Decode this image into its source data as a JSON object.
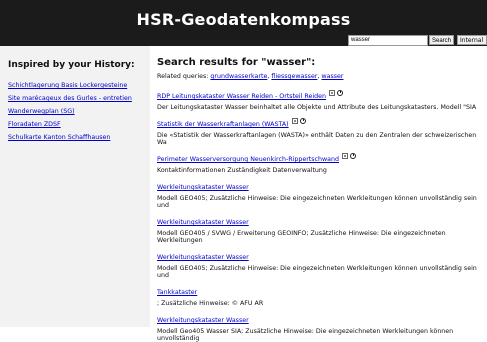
{
  "header": {
    "title": "HSR-Geodatenkompass",
    "search_value": "wasser",
    "search_button": "Search",
    "scope_value": "Internal"
  },
  "sidebar": {
    "heading": "Inspired by your History:",
    "links": [
      "Schichtlagerung Basis Lockergesteine",
      "Site marécageux des Gurles - entretien",
      "Wanderwegplan (SG)",
      "Floradaten ZDSF",
      "Schulkarte Kanton Schaffhausen"
    ]
  },
  "main": {
    "heading": "Search results for \"wasser\":",
    "related_label": "Related queries:",
    "related_queries": [
      "grundwasserkarte",
      "fliessgewasser",
      "wasser"
    ],
    "results": [
      {
        "title": "RDP Leitungskataster Wasser Reiden - Ortsteil Reiden",
        "snippet": "Der Leitungskataster Wasser beinhaltet alle Objekte und Attribute des Leitungskatasters. Modell \"SIA",
        "icons": true
      },
      {
        "title": "Statistik der Wasserkraftanlagen (WASTA)",
        "snippet": "Die «Statistik der Wasserkraftanlagen (WASTA)» enthält Daten zu den Zentralen der schweizerischen Wa",
        "icons": true
      },
      {
        "title": "Perimeter Wasserversorgung Neuenkirch-Rippertschwand",
        "snippet": "Kontaktinformationen Zuständigkeit Datenverwaltung",
        "icons": true
      },
      {
        "title": "Werkleitungskataster Wasser",
        "snippet": "Modell GEO405; Zusätzliche Hinweise: Die eingezeichneten Werkleitungen können unvollständig sein und",
        "icons": false
      },
      {
        "title": "Werkleitungskataster Wasser",
        "snippet": "Modell GEO405 / SVWG / Erweiterung GEOINFO; Zusätzliche Hinweise: Die eingezeichneten Werkleitungen",
        "icons": false
      },
      {
        "title": "Werkleitungskataster Wasser",
        "snippet": "Modell GEO405; Zusätzliche Hinweise: Die eingezeichneten Werkleitungen können unvollständig sein und",
        "icons": false
      },
      {
        "title": "Tankkataster",
        "snippet": "; Zusätzliche Hinweise: © AFU AR",
        "icons": false
      },
      {
        "title": "Werkleitungskataster Wasser",
        "snippet": "Modell Geo405 Wasser SIA; Zusätzliche Hinweise: Die eingezeichneten Werkleitungen können unvollständig",
        "icons": false
      }
    ]
  },
  "icons": {
    "map": "map-icon",
    "history": "clock-icon"
  }
}
